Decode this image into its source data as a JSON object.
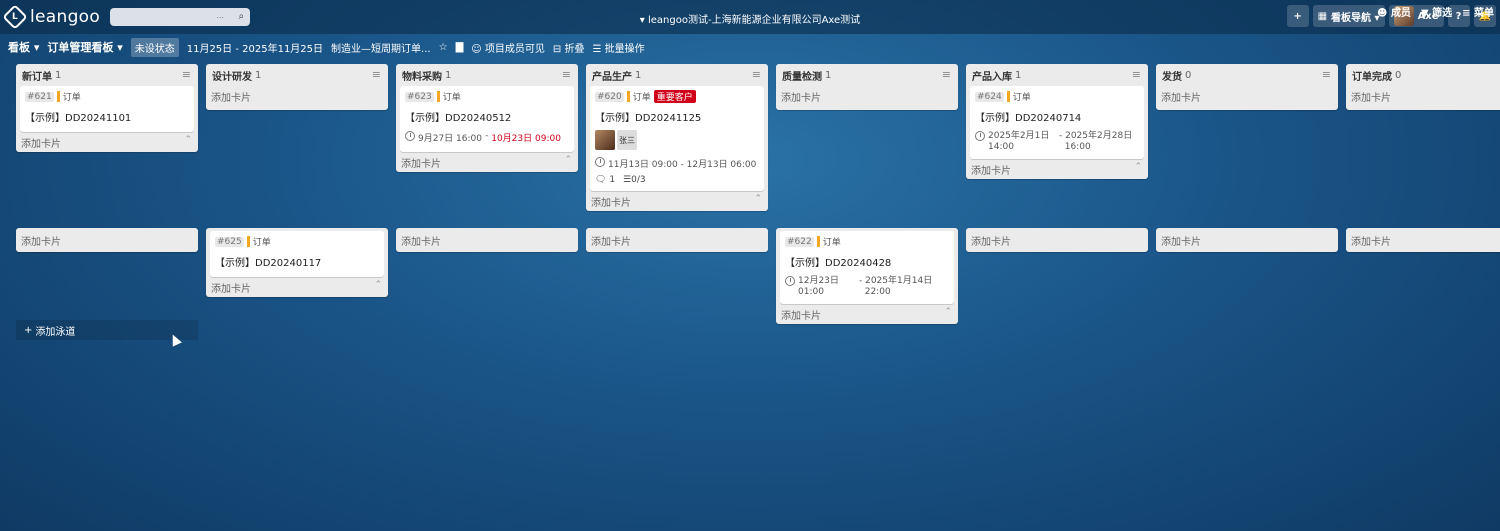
{
  "app": {
    "logo_text": "leangoo",
    "logo_glyph": "L",
    "window_title": "▾ leangoo测试-上海新能源企业有限公司Axe测试"
  },
  "topbar": {
    "search_placeholder": "",
    "search_dots": "...",
    "search_icon": "magnifier-icon",
    "add_label": "+",
    "board_nav_label": "看板导航 ▾",
    "board_nav_icon": "grid-icon",
    "user_name": "Axe",
    "help_label": "?",
    "notifications_icon": "bell-icon"
  },
  "boardbar": {
    "view_label": "看板 ▾",
    "board_title": "订单管理看板 ▾",
    "status": "未设状态",
    "date_range": "11月25日 - 2025年11月25日",
    "description": "制造业—短周期订单...",
    "star_icon": "star-icon",
    "chart_icon": "chart-icon",
    "visibility_label": "项目成员可见",
    "collapse_label": "折叠",
    "batch_label": "批量操作",
    "members_label": "成员",
    "filter_label": "筛选",
    "menu_label": "菜单"
  },
  "lists": [
    {
      "title": "新订单",
      "count": "1"
    },
    {
      "title": "设计研发",
      "count": "1"
    },
    {
      "title": "物料采购",
      "count": "1"
    },
    {
      "title": "产品生产",
      "count": "1"
    },
    {
      "title": "质量检测",
      "count": "1"
    },
    {
      "title": "产品入库",
      "count": "1"
    },
    {
      "title": "发货",
      "count": "0"
    },
    {
      "title": "订单完成",
      "count": "0"
    }
  ],
  "common": {
    "add_card": "添加卡片",
    "add_lane": "添加泳道",
    "tag_order": "订单"
  },
  "cards": {
    "c621": {
      "num": "#621",
      "title": "【示例】DD20241101"
    },
    "c623": {
      "num": "#623",
      "title": "【示例】DD20240512",
      "start": "9月27日 16:00",
      "sep": " - ",
      "end": "10月23日 09:00"
    },
    "c620": {
      "num": "#620",
      "badge": "重要客户",
      "title": "【示例】DD20241125",
      "member": "张三",
      "dates": "11月13日 09:00 - 12月13日 06:00",
      "comments": "1",
      "checklist": "0/3"
    },
    "c624": {
      "num": "#624",
      "title": "【示例】DD20240714",
      "start_a": "2025年2月1日",
      "start_b": "14:00",
      "end_a": "- 2025年2月28日",
      "end_b": "16:00"
    },
    "c625": {
      "num": "#625",
      "title": "【示例】DD20240117"
    },
    "c622": {
      "num": "#622",
      "title": "【示例】DD20240428",
      "start_a": "12月23日",
      "start_b": "01:00",
      "end_a": "- 2025年1月14日",
      "end_b": "22:00"
    }
  }
}
